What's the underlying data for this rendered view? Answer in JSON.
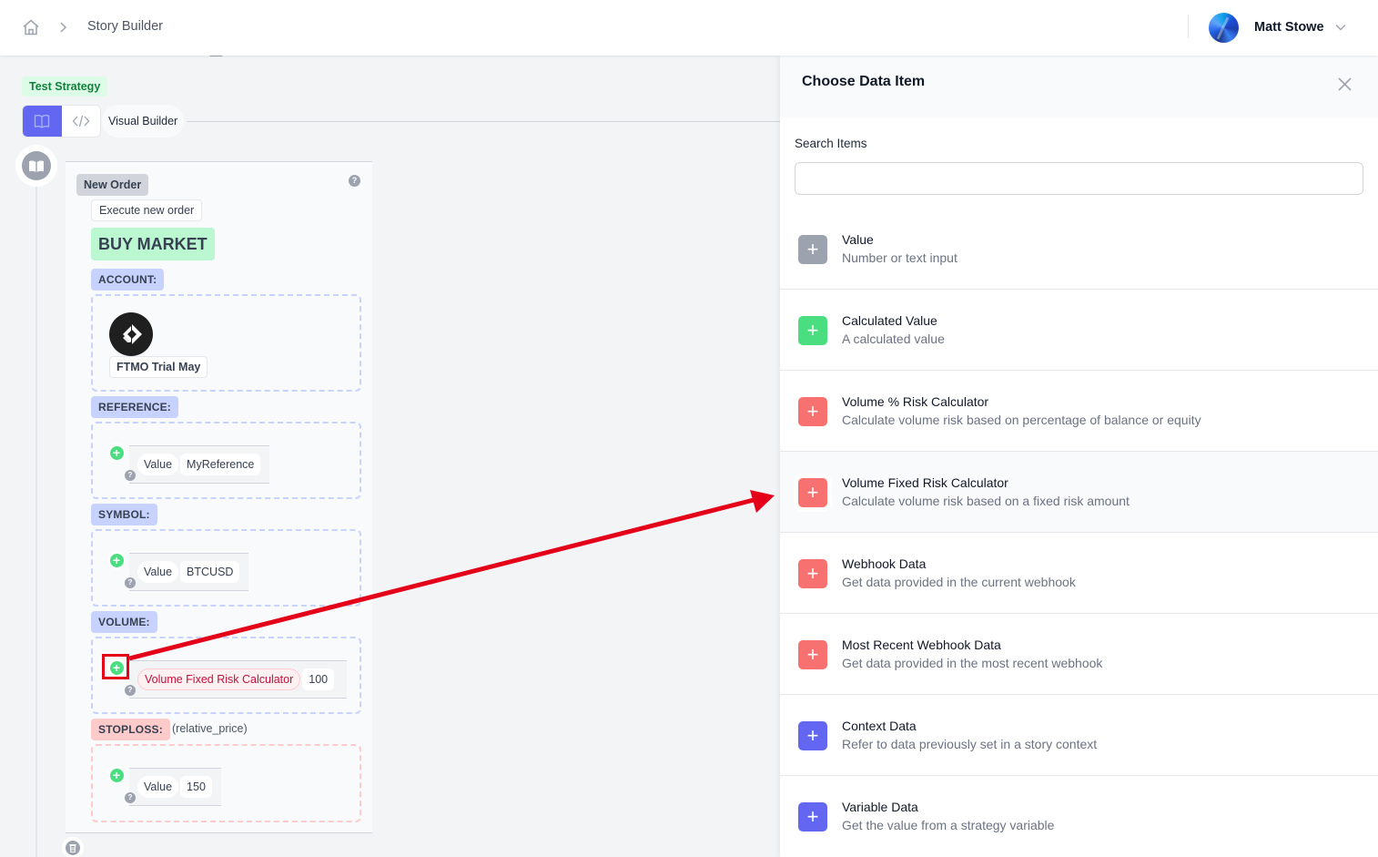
{
  "topbar": {
    "breadcrumb": {
      "home_icon": "home-icon",
      "separator_icon": "chevron-right-icon",
      "current": "Story Builder"
    },
    "user": {
      "name": "Matt Stowe",
      "avatar_icon": "avatar",
      "menu_icon": "chevron-down-icon"
    }
  },
  "builder": {
    "strategy_badge": "Test Strategy",
    "mode_toggle": {
      "active": "visual",
      "visual_icon": "book-open-icon",
      "code_icon": "code-icon"
    },
    "mode_label": "Visual Builder",
    "timeline_icon": "book-open-icon",
    "block": {
      "title": "New Order",
      "description": "Execute new order",
      "action": "BUY MARKET",
      "help_icon": "question-icon",
      "params": {
        "account": {
          "label": "ACCOUNT:",
          "account_name": "FTMO Trial May",
          "logo_icon": "ftmo-logo"
        },
        "reference": {
          "label": "REFERENCE:",
          "type": "Value",
          "value": "MyReference"
        },
        "symbol": {
          "label": "SYMBOL:",
          "type": "Value",
          "value": "BTCUSD"
        },
        "volume": {
          "label": "VOLUME:",
          "type": "Volume Fixed Risk Calculator",
          "value": "100"
        },
        "stoploss": {
          "label": "STOPLOSS:",
          "note": "(relative_price)",
          "type": "Value",
          "value": "150"
        }
      },
      "add_icon": "plus-circle-icon",
      "delete_icon": "trash-icon"
    }
  },
  "panel": {
    "title": "Choose Data Item",
    "close_icon": "close-icon",
    "search": {
      "label": "Search Items",
      "value": "",
      "placeholder": ""
    },
    "items": [
      {
        "title": "Value",
        "description": "Number or text input",
        "color": "#9ca3af"
      },
      {
        "title": "Calculated Value",
        "description": "A calculated value",
        "color": "#4ade80"
      },
      {
        "title": "Volume % Risk Calculator",
        "description": "Calculate volume risk based on percentage of balance or equity",
        "color": "#f87171"
      },
      {
        "title": "Volume Fixed Risk Calculator",
        "description": "Calculate volume risk based on a fixed risk amount",
        "color": "#f87171",
        "highlighted": true
      },
      {
        "title": "Webhook Data",
        "description": "Get data provided in the current webhook",
        "color": "#f87171"
      },
      {
        "title": "Most Recent Webhook Data",
        "description": "Get data provided in the most recent webhook",
        "color": "#f87171"
      },
      {
        "title": "Context Data",
        "description": "Refer to data previously set in a story context",
        "color": "#6366f1"
      },
      {
        "title": "Variable Data",
        "description": "Get the value from a strategy variable",
        "color": "#6366f1"
      }
    ]
  },
  "annotation": {
    "color": "#e5001a",
    "from": "volume-add-button",
    "to": "item-volume-fixed-risk-calculator"
  }
}
